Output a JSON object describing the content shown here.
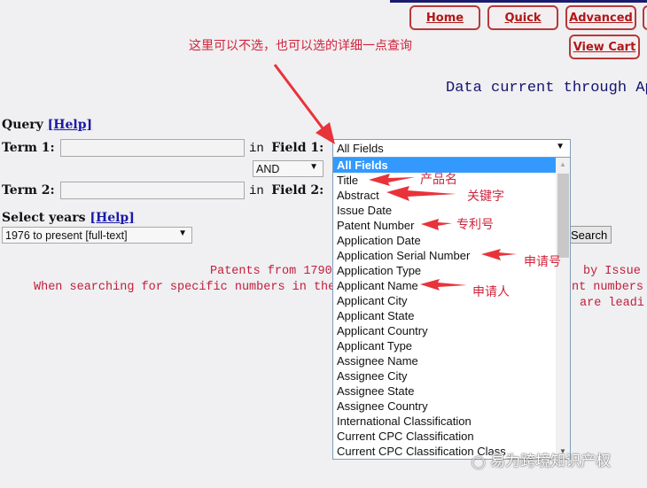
{
  "nav": {
    "home": "Home",
    "quick": "Quick",
    "advanced": "Advanced",
    "view_cart": "View Cart"
  },
  "annotations": {
    "top_note": "这里可以不选，也可以选的详细一点查询",
    "title": "产品名",
    "abstract": "关键字",
    "patent_number": "专利号",
    "application_serial_number": "申请号",
    "applicant_name": "申请人",
    "arrow_color": "#e8333a"
  },
  "header": {
    "data_current": "Data current through Apr"
  },
  "form": {
    "query_label": "Query",
    "help_label": "[Help]",
    "term1_label": "Term 1:",
    "term2_label": "Term 2:",
    "in_label": "in",
    "field1_label": "Field 1:",
    "field2_label": "Field 2:",
    "term1_value": "",
    "term2_value": "",
    "operator": "AND",
    "select_years_label": "Select years",
    "years_value": "1976 to present [full-text]",
    "search_button": "Search"
  },
  "field_dropdown": {
    "selected": "All Fields",
    "options": [
      "All Fields",
      "Title",
      "Abstract",
      "Issue Date",
      "Patent Number",
      "Application Date",
      "Application Serial Number",
      "Application Type",
      "Applicant Name",
      "Applicant City",
      "Applicant State",
      "Applicant Country",
      "Applicant Type",
      "Assignee Name",
      "Assignee City",
      "Assignee State",
      "Assignee Country",
      "International Classification",
      "Current CPC Classification",
      "Current CPC Classification Class"
    ]
  },
  "notes": {
    "line1_left": "Patents from 1790",
    "line1_right": "by Issue Da",
    "line2_left": "When searching for specific numbers in the",
    "line2_right": "nt numbers",
    "line3_right": "are leadi"
  },
  "watermark": "易为跨境知识产权"
}
